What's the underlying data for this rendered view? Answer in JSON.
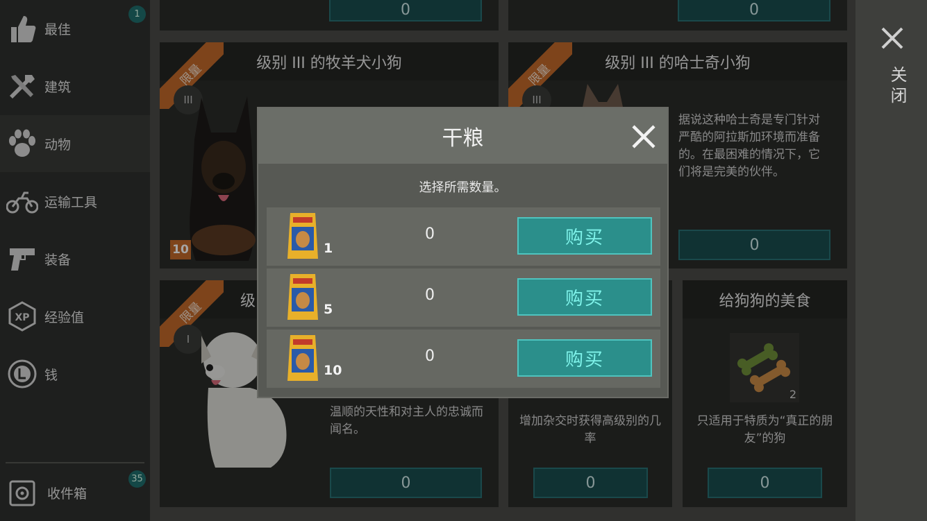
{
  "sidebar": {
    "items": [
      {
        "label": "最佳",
        "badge": "1"
      },
      {
        "label": "建筑"
      },
      {
        "label": "动物"
      },
      {
        "label": "运输工具"
      },
      {
        "label": "装备"
      },
      {
        "label": "经验值"
      },
      {
        "label": "钱"
      }
    ],
    "inbox": {
      "label": "收件箱",
      "badge": "35"
    }
  },
  "close_panel": {
    "label": "关闭"
  },
  "cards": {
    "top_left_price": "0",
    "top_right_price": "0",
    "shepherd": {
      "ribbon": "限量",
      "title": "级别 III 的牧羊犬小狗",
      "level": "III",
      "count": "10"
    },
    "husky": {
      "ribbon": "限量",
      "title": "级别 III 的哈士奇小狗",
      "level": "III",
      "description": "据说这种哈士奇是专门针对严酷的阿拉斯加环境而准备的。在最困难的情况下，它们将是完美的伙伴。",
      "price": "0"
    },
    "white_puppy": {
      "ribbon": "限量",
      "title_partial": "级",
      "level": "I",
      "description_partial": "温顺的天性和对主人的忠诚而闻名。",
      "price": "0"
    },
    "breeding": {
      "description": "增加杂交时获得高级别的几率",
      "price": "0"
    },
    "dog_treat": {
      "title": "给狗狗的美食",
      "count": "2",
      "description": "只适用于特质为“真正的朋友”的狗",
      "price": "0"
    }
  },
  "dialog": {
    "title": "干粮",
    "subtitle": "选择所需数量。",
    "rows": [
      {
        "quantity": "1",
        "amount": "0",
        "buy_label": "购买"
      },
      {
        "quantity": "5",
        "amount": "0",
        "buy_label": "购买"
      },
      {
        "quantity": "10",
        "amount": "0",
        "buy_label": "购买"
      }
    ]
  },
  "colors": {
    "accent_teal": "#2b8f8b",
    "ribbon_orange": "#c2692a",
    "badge_teal": "#1f6f6d"
  }
}
